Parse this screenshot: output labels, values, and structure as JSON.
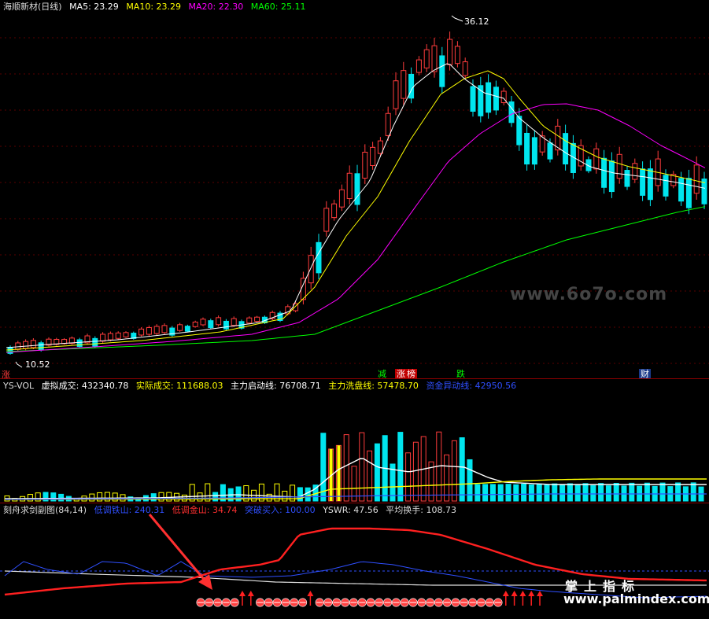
{
  "header": {
    "title": "海顺新材(日线)",
    "ma5": "MA5: 23.29",
    "ma10": "MA10: 23.29",
    "ma20": "MA20: 22.30",
    "ma60": "MA60: 25.11"
  },
  "annotations": {
    "high": "36.12",
    "low": "10.52"
  },
  "signals": {
    "s1": "减",
    "s2": "涨",
    "s3": "榜",
    "s4": "跌",
    "s5": "财",
    "left_marker": "涨"
  },
  "vol_header": {
    "name": "YS-VOL",
    "virtual": "虚拟成交: 432340.78",
    "actual": "实际成交: 111688.03",
    "main_start": "主力启动线: 76708.71",
    "main_wash": "主力洗盘线: 57478.70",
    "capital_out": "资金异动线: 42950.56"
  },
  "ind_header": {
    "name": "刻舟求剑副图(84,14)",
    "low_iron": "低调铁山: 240.31",
    "low_gold": "低调金山: 34.74",
    "breakout": "突破买入: 100.00",
    "yswr": "YSWR: 47.56",
    "turnover": "平均换手: 108.73"
  },
  "watermark": {
    "top": "www.6o7o.com",
    "brand": "掌上指标",
    "site": "www.palmindex.com"
  },
  "colors": {
    "up": "#ff3c3c",
    "down": "#00e5ee",
    "ma5": "#ffffff",
    "ma10": "#ffff00",
    "ma20": "#ff00ff",
    "ma60": "#00ff00",
    "iron": "#2f4fff",
    "gold": "#ff2020",
    "arrow": "#ff2020"
  },
  "chart_data": [
    {
      "type": "candlestick",
      "title": "海顺新材(日线)",
      "price_high": 36.12,
      "price_low": 10.52,
      "series": [
        {
          "name": "MA5",
          "value": 23.29
        },
        {
          "name": "MA10",
          "value": 23.29
        },
        {
          "name": "MA20",
          "value": 22.3
        },
        {
          "name": "MA60",
          "value": 25.11
        }
      ]
    },
    {
      "type": "bar",
      "title": "YS-VOL",
      "series": [
        {
          "name": "虚拟成交",
          "value": 432340.78
        },
        {
          "name": "实际成交",
          "value": 111688.03
        },
        {
          "name": "主力启动线",
          "value": 76708.71
        },
        {
          "name": "主力洗盘线",
          "value": 57478.7
        },
        {
          "name": "资金异动线",
          "value": 42950.56
        }
      ]
    },
    {
      "type": "line",
      "title": "刻舟求剑副图(84,14)",
      "series": [
        {
          "name": "低调铁山",
          "value": 240.31
        },
        {
          "name": "低调金山",
          "value": 34.74
        },
        {
          "name": "突破买入",
          "value": 100.0
        },
        {
          "name": "YSWR",
          "value": 47.56
        },
        {
          "name": "平均换手",
          "value": 108.73
        }
      ]
    }
  ]
}
